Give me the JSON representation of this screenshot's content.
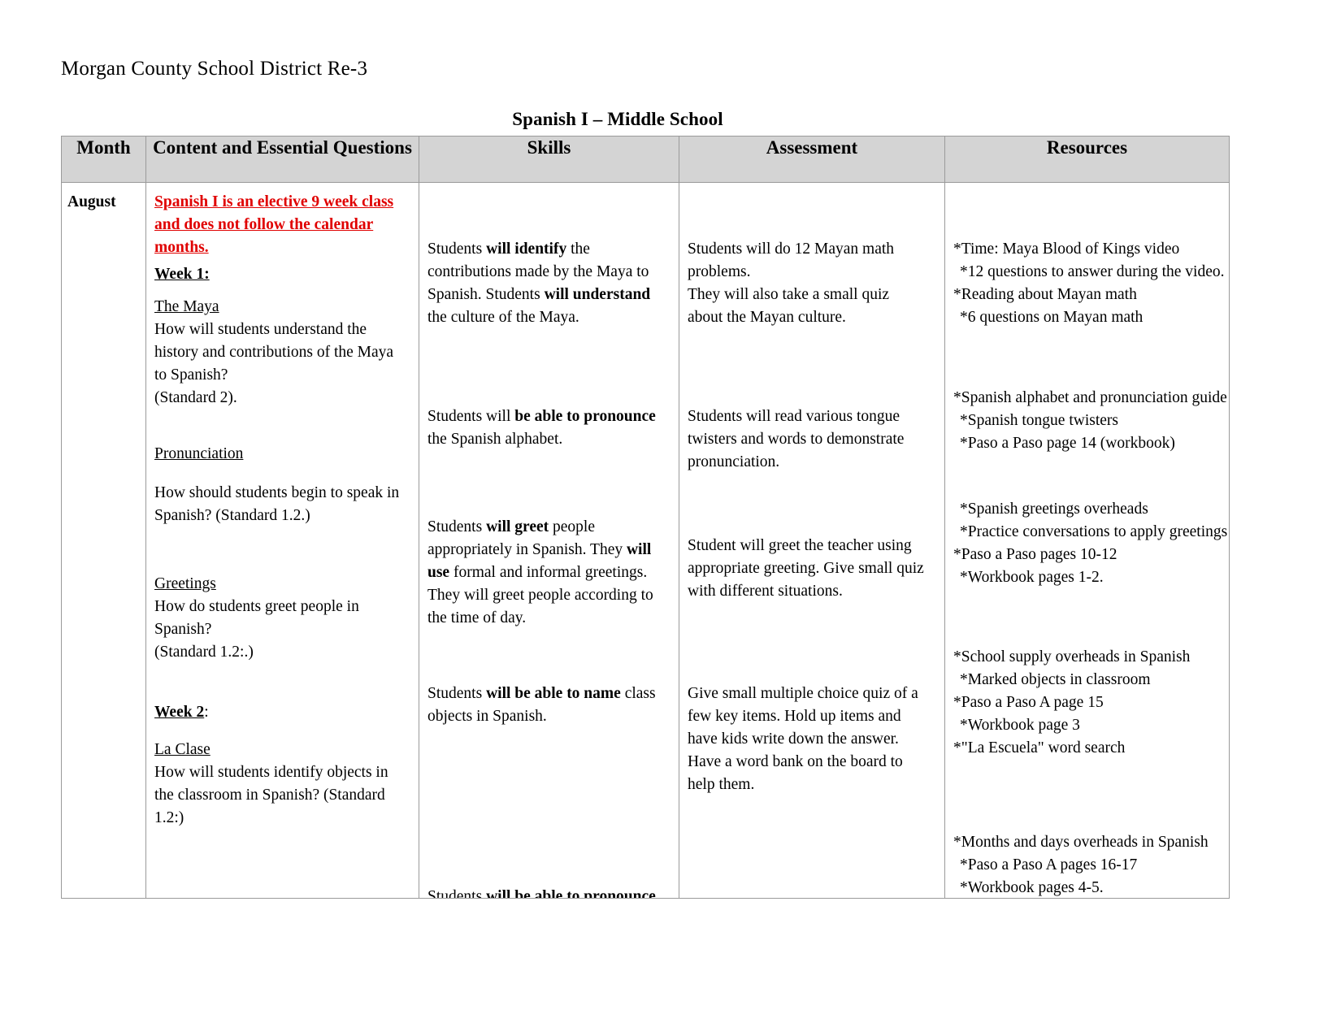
{
  "document": {
    "district_title": "Morgan County School District Re-3",
    "course_title": "Spanish I – Middle School"
  },
  "table": {
    "headers": {
      "month": "Month",
      "content": "Content and Essential Questions",
      "skills": "Skills",
      "assessment": "Assessment",
      "resources": "Resources"
    },
    "month": "August",
    "content": {
      "notice": "Spanish I is an elective 9 week class and does not follow the calendar months.",
      "week1_label": "Week 1:",
      "topic_maya": "The Maya",
      "maya_question_line1": " How will students understand the",
      "maya_question_line2": "history and contributions of the Maya",
      "maya_question_line3": "to Spanish?",
      "maya_standard": " (Standard 2).",
      "topic_pronunciation": "Pronunciation",
      "pronunciation_question_line1": "How should students begin to speak in",
      "pronunciation_question_line2": "Spanish? (Standard 1.2.)",
      "topic_greetings": "Greetings",
      "greetings_question_line1": " How do students greet people in",
      "greetings_question_line2": "Spanish?",
      "greetings_standard": " (Standard 1.2:.)",
      "week2_label": "Week 2",
      "week2_colon": ":",
      "topic_la_clase": "La Clase",
      "la_clase_question_line1": " How will students identify objects in",
      "la_clase_question_line2": "the classroom in Spanish? (Standard",
      "la_clase_question_line3": "1.2:)"
    },
    "skills": {
      "maya_1": "Students ",
      "maya_1_bold": "will identify",
      "maya_2": " the contributions made by the Maya to Spanish. Students ",
      "maya_2_bold": "will understand",
      "maya_3": " the culture of the Maya.",
      "pron_1": "Students will ",
      "pron_1_bold": "be able to pronounce",
      "pron_2": " the Spanish alphabet.",
      "greet_1": "Students ",
      "greet_1_bold": "will greet",
      "greet_2": " people appropriately in Spanish. They ",
      "greet_2_bold": "will use",
      "greet_3": " formal and informal greetings. They will greet people according to the time of day.",
      "clase_1": "Students ",
      "clase_1_bold": "will be able to name",
      "clase_2": " class objects in Spanish.",
      "last_1": "Students ",
      "last_1_bold": "will be able to pronounce"
    },
    "assessment": {
      "maya_line1": "Students will do 12 Mayan math",
      "maya_line2": "problems.",
      "maya_line3": " They will also take a small quiz",
      "maya_line4": "about the Mayan culture.",
      "pron_line1": "Students will read various tongue",
      "pron_line2": "twisters and words to demonstrate",
      "pron_line3": "pronunciation.",
      "greet_line1": "Student will greet the teacher using",
      "greet_line2": "appropriate greeting. Give small quiz",
      "greet_line3": "with different situations.",
      "clase_line1": "Give small multiple choice quiz of a",
      "clase_line2": "few key items. Hold up items and",
      "clase_line3": "have kids write down the answer.",
      "clase_line4": "Have a word bank on the board to",
      "clase_line5": "help them."
    },
    "resources": {
      "maya": [
        "*Time: Maya Blood of Kings video",
        "*12 questions to answer during the video.",
        "*Reading about Mayan math",
        "*6 questions on Mayan math"
      ],
      "pronunciation": [
        "*Spanish alphabet and pronunciation guide",
        "*Spanish tongue twisters",
        "*Paso a Paso page 14 (workbook)"
      ],
      "greetings": [
        "*Spanish greetings overheads",
        "*Practice conversations to apply greetings",
        "*Paso a Paso pages 10-12",
        "*Workbook pages 1-2."
      ],
      "la_clase": [
        "*School supply overheads in Spanish",
        "*Marked objects in classroom",
        "*Paso a Paso A page 15",
        "*Workbook page 3",
        "*\"La Escuela\" word search"
      ],
      "months_days": [
        "*Months and days overheads in Spanish",
        "*Paso a Paso A pages 16-17",
        "*Workbook pages 4-5."
      ]
    }
  }
}
